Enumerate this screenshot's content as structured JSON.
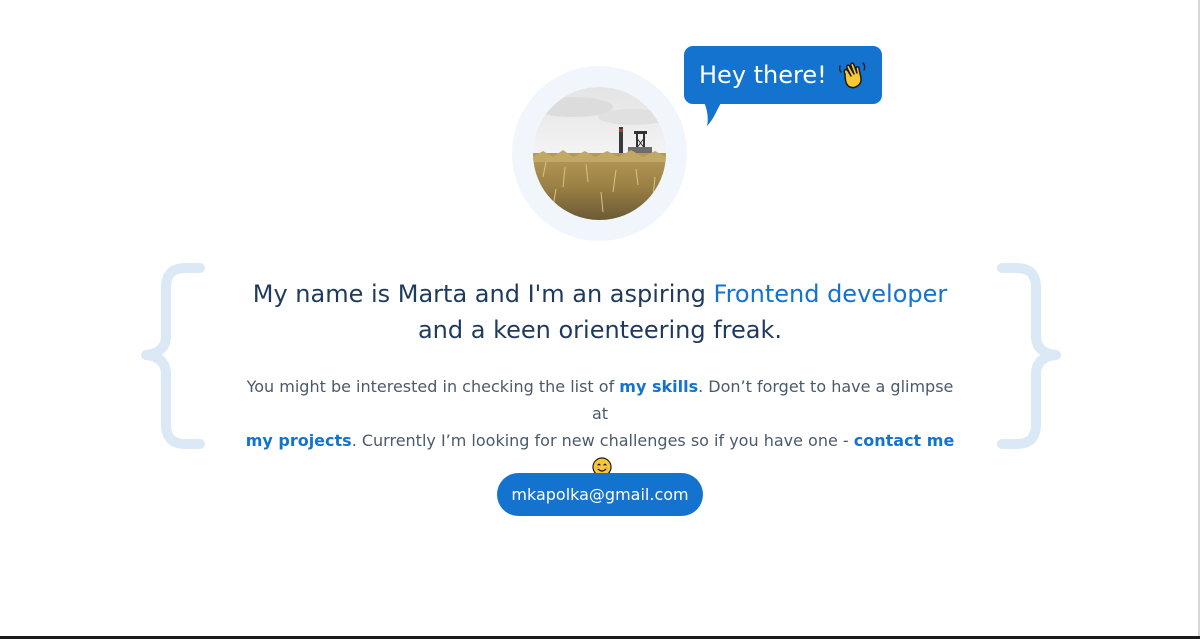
{
  "speech_bubble": {
    "text": "Hey there!",
    "icon": "waving-hand-icon"
  },
  "avatar": {
    "alt": "landscape-photo-avatar"
  },
  "headline": {
    "part1": "My name is Marta and I'm an aspiring ",
    "accent": "Frontend developer",
    "part2": "and a keen orienteering freak."
  },
  "intro": {
    "text1": "You might be interested in checking the list of ",
    "link_skills": "my skills",
    "text2": ". Don’t forget to have a glimpse at ",
    "link_projects": "my projects",
    "text3": ". Currently I’m looking for new challenges so if you have one - ",
    "link_contact": "contact me",
    "emoji": "smiling-face-icon"
  },
  "email_button": {
    "label": "mkapolka@gmail.com"
  },
  "colors": {
    "accent": "#1373cf",
    "heading": "#1f3a5c",
    "body_text": "#4b5a6b",
    "brace": "#dbe8f5"
  }
}
